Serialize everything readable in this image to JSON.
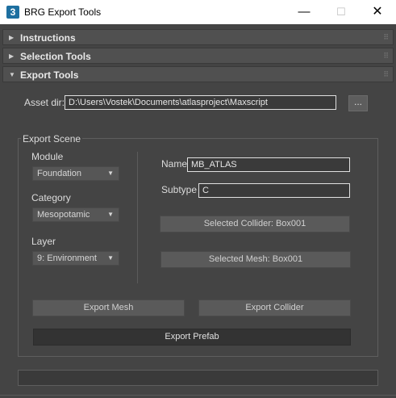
{
  "window": {
    "app_icon": "3",
    "title": "BRG Export Tools",
    "minimize": "—",
    "maximize": "☐",
    "close": "✕"
  },
  "rollouts": [
    {
      "title": "Instructions",
      "state": "collapsed"
    },
    {
      "title": "Selection Tools",
      "state": "collapsed"
    },
    {
      "title": "Export Tools",
      "state": "expanded"
    }
  ],
  "asset_dir": {
    "label": "Asset dir:",
    "value": "D:\\Users\\Vostek\\Documents\\atlasproject\\Maxscript",
    "browse_label": "..."
  },
  "export_scene": {
    "title": "Export Scene",
    "module": {
      "label": "Module",
      "selected": "Foundation"
    },
    "category": {
      "label": "Category",
      "selected": "Mesopotamic"
    },
    "layer": {
      "label": "Layer",
      "selected": "9: Environment"
    },
    "name": {
      "label": "Name",
      "value": "MB_ATLAS"
    },
    "subtype": {
      "label": "Subtype",
      "value": "C"
    },
    "selected_collider": "Selected Collider: Box001",
    "selected_mesh": "Selected Mesh: Box001",
    "export_mesh": "Export Mesh",
    "export_collider": "Export Collider",
    "export_prefab": "Export Prefab"
  },
  "progress": {
    "value": 0
  },
  "icons": {
    "collapsed": "triangle-right-icon",
    "expanded": "triangle-down-icon",
    "dropdown": "triangle-down-icon",
    "grip": "grip-dots-icon"
  }
}
